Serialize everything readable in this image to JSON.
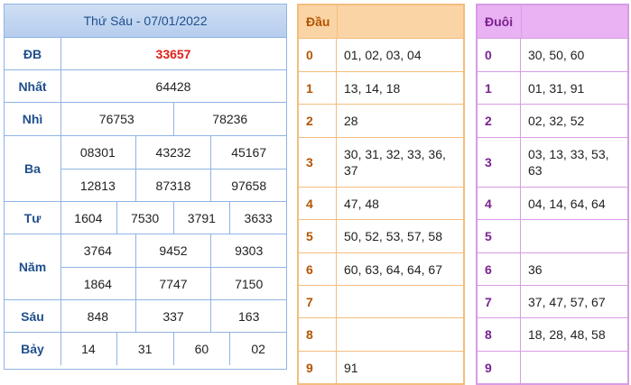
{
  "results": {
    "header": "Thứ Sáu - 07/01/2022",
    "rows": [
      {
        "label": "ĐB",
        "lines": [
          [
            "33657"
          ]
        ]
      },
      {
        "label": "Nhất",
        "lines": [
          [
            "64428"
          ]
        ]
      },
      {
        "label": "Nhì",
        "lines": [
          [
            "76753",
            "78236"
          ]
        ]
      },
      {
        "label": "Ba",
        "lines": [
          [
            "08301",
            "43232",
            "45167"
          ],
          [
            "12813",
            "87318",
            "97658"
          ]
        ]
      },
      {
        "label": "Tư",
        "lines": [
          [
            "1604",
            "7530",
            "3791",
            "3633"
          ]
        ]
      },
      {
        "label": "Năm",
        "lines": [
          [
            "3764",
            "9452",
            "9303"
          ],
          [
            "1864",
            "7747",
            "7150"
          ]
        ]
      },
      {
        "label": "Sáu",
        "lines": [
          [
            "848",
            "337",
            "163"
          ]
        ]
      },
      {
        "label": "Bảy",
        "lines": [
          [
            "14",
            "31",
            "60",
            "02"
          ]
        ]
      }
    ]
  },
  "dau": {
    "header": "Đầu",
    "rows": [
      {
        "key": "0",
        "value": "01, 02, 03, 04"
      },
      {
        "key": "1",
        "value": "13, 14, 18"
      },
      {
        "key": "2",
        "value": "28"
      },
      {
        "key": "3",
        "value": "30, 31, 32, 33, 36, 37"
      },
      {
        "key": "4",
        "value": "47, 48"
      },
      {
        "key": "5",
        "value": "50, 52, 53, 57, 58"
      },
      {
        "key": "6",
        "value": "60, 63, 64, 64, 67"
      },
      {
        "key": "7",
        "value": ""
      },
      {
        "key": "8",
        "value": ""
      },
      {
        "key": "9",
        "value": "91"
      }
    ]
  },
  "duoi": {
    "header": "Đuôi",
    "rows": [
      {
        "key": "0",
        "value": "30, 50, 60"
      },
      {
        "key": "1",
        "value": "01, 31, 91"
      },
      {
        "key": "2",
        "value": "02, 32, 52"
      },
      {
        "key": "3",
        "value": "03, 13, 33, 53, 63"
      },
      {
        "key": "4",
        "value": "04, 14, 64, 64"
      },
      {
        "key": "5",
        "value": ""
      },
      {
        "key": "6",
        "value": "36"
      },
      {
        "key": "7",
        "value": "37, 47, 57, 67"
      },
      {
        "key": "8",
        "value": "18, 28, 48, 58"
      },
      {
        "key": "9",
        "value": ""
      }
    ]
  },
  "colors": {
    "special_prize": "#e0201b",
    "results_accent": "#1f4f8c",
    "dau_accent": "#b35400",
    "duoi_accent": "#7a2290"
  }
}
